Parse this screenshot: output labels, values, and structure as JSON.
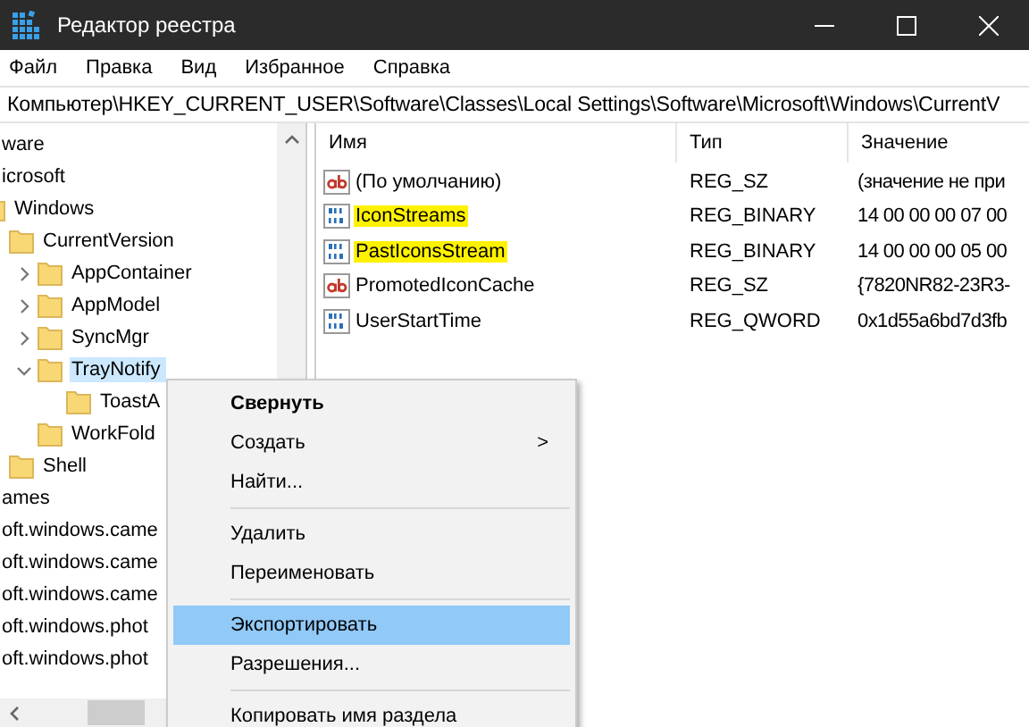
{
  "window": {
    "title": "Редактор реестра"
  },
  "menu": [
    "Файл",
    "Правка",
    "Вид",
    "Избранное",
    "Справка"
  ],
  "address": "Компьютер\\HKEY_CURRENT_USER\\Software\\Classes\\Local Settings\\Software\\Microsoft\\Windows\\CurrentV",
  "tree": [
    {
      "label": "ware",
      "selected": false,
      "children": [
        {
          "label": "icrosoft",
          "selected": false,
          "children": [
            {
              "label": "Windows",
              "selected": false,
              "children": [
                {
                  "label": "CurrentVersion",
                  "selected": false,
                  "children": [
                    {
                      "label": "AppContainer",
                      "selected": false,
                      "expanded": false
                    },
                    {
                      "label": "AppModel",
                      "selected": false,
                      "expanded": false
                    },
                    {
                      "label": "SyncMgr",
                      "selected": false,
                      "expanded": false
                    },
                    {
                      "label": "TrayNotify",
                      "selected": true,
                      "expanded": true,
                      "children": [
                        {
                          "label": "ToastA",
                          "selected": false
                        }
                      ]
                    },
                    {
                      "label": "WorkFold",
                      "selected": false
                    }
                  ]
                },
                {
                  "label": "Shell",
                  "selected": false
                }
              ]
            }
          ]
        }
      ]
    },
    {
      "label": "ames",
      "selected": false
    },
    {
      "label": "oft.windows.came",
      "selected": false
    },
    {
      "label": "oft.windows.came",
      "selected": false
    },
    {
      "label": "oft.windows.came",
      "selected": false
    },
    {
      "label": "oft.windows.phot",
      "selected": false
    },
    {
      "label": "oft.windows.phot",
      "selected": false
    }
  ],
  "columns": [
    "Имя",
    "Тип",
    "Значение"
  ],
  "values": [
    {
      "kind": "string",
      "name": "(По умолчанию)",
      "type": "REG_SZ",
      "value": "(значение не при",
      "highlighted": false
    },
    {
      "kind": "binary",
      "name": "IconStreams",
      "type": "REG_BINARY",
      "value": "14 00 00 00 07 00",
      "highlighted": true
    },
    {
      "kind": "binary",
      "name": "PastIconsStream",
      "type": "REG_BINARY",
      "value": "14 00 00 00 05 00",
      "highlighted": true
    },
    {
      "kind": "string",
      "name": "PromotedIconCache",
      "type": "REG_SZ",
      "value": "{7820NR82-23R3-",
      "highlighted": false
    },
    {
      "kind": "binary",
      "name": "UserStartTime",
      "type": "REG_QWORD",
      "value": "0x1d55a6bd7d3fb",
      "highlighted": false
    }
  ],
  "context_menu": [
    {
      "kind": "item",
      "label": "Свернуть",
      "default": true,
      "selected": false
    },
    {
      "kind": "item",
      "label": "Создать",
      "default": false,
      "selected": false,
      "submenu": ">"
    },
    {
      "kind": "item",
      "label": "Найти...",
      "default": false,
      "selected": false
    },
    {
      "kind": "separator"
    },
    {
      "kind": "item",
      "label": "Удалить",
      "default": false,
      "selected": false
    },
    {
      "kind": "item",
      "label": "Переименовать",
      "default": false,
      "selected": false
    },
    {
      "kind": "separator"
    },
    {
      "kind": "item",
      "label": "Экспортировать",
      "default": false,
      "selected": true
    },
    {
      "kind": "item",
      "label": "Разрешения...",
      "default": false,
      "selected": false
    },
    {
      "kind": "separator"
    },
    {
      "kind": "item",
      "label": "Копировать имя раздела",
      "default": false,
      "selected": false
    }
  ]
}
